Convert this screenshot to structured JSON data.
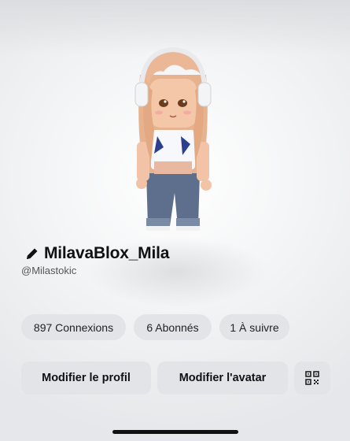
{
  "profile": {
    "display_name": "MilavaBlox_Mila",
    "username": "@Milastokic"
  },
  "stats": {
    "connections": "897 Connexions",
    "followers": "6 Abonnés",
    "following": "1 À suivre"
  },
  "actions": {
    "edit_profile": "Modifier le profil",
    "edit_avatar": "Modifier l'avatar",
    "qr_icon": "qr-code-icon"
  },
  "icons": {
    "edit": "pencil-icon"
  }
}
